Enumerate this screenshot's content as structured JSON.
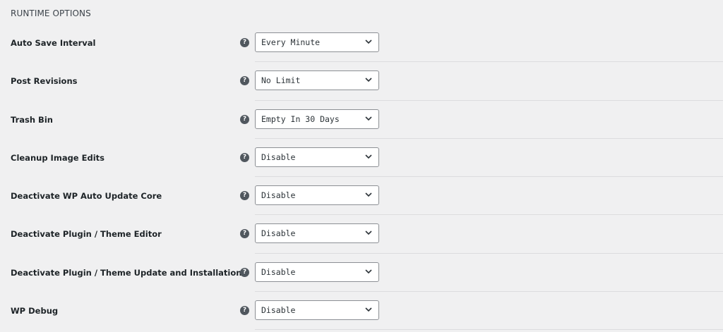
{
  "section": {
    "title": "RUNTIME OPTIONS"
  },
  "help_icon_glyph": "?",
  "options": [
    {
      "label": "Auto Save Interval",
      "value": "Every Minute"
    },
    {
      "label": "Post Revisions",
      "value": "No Limit"
    },
    {
      "label": "Trash Bin",
      "value": "Empty In 30 Days"
    },
    {
      "label": "Cleanup Image Edits",
      "value": "Disable"
    },
    {
      "label": "Deactivate WP Auto Update Core",
      "value": "Disable"
    },
    {
      "label": "Deactivate Plugin / Theme Editor",
      "value": "Disable"
    },
    {
      "label": "Deactivate Plugin / Theme Update and Installation",
      "value": "Disable"
    },
    {
      "label": "WP Debug",
      "value": "Disable"
    }
  ],
  "icons": {
    "help": "question-circle-icon",
    "dropdown": "chevron-down-icon"
  },
  "colors": {
    "background": "#f0f0f1",
    "help_icon": "#50575e",
    "select_border": "#8c8f94",
    "divider": "#dcdcde"
  }
}
